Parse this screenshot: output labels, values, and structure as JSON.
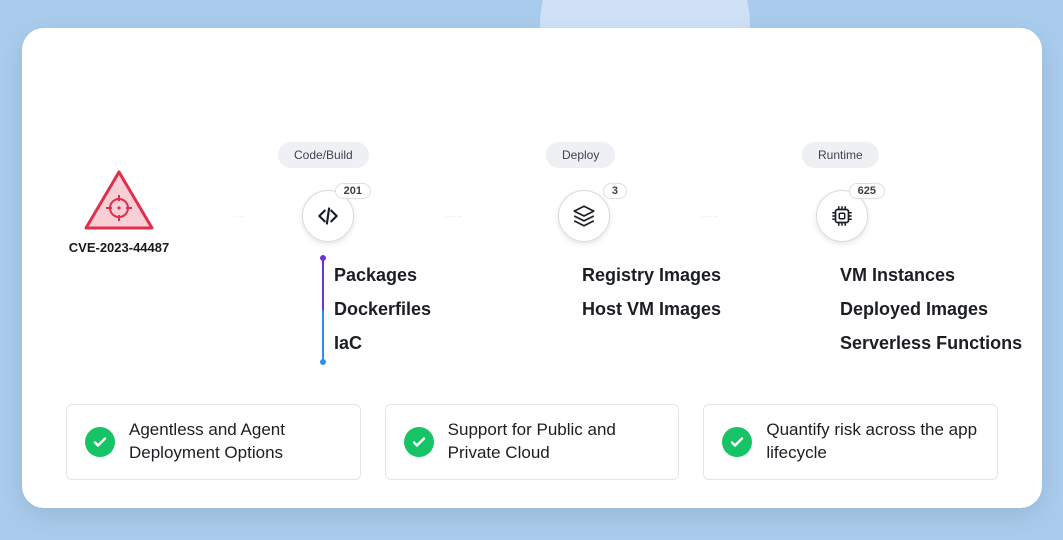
{
  "cve": {
    "id": "CVE-2023-44487"
  },
  "stages": [
    {
      "key": "code_build",
      "label": "Code/Build",
      "count": "201",
      "items": [
        "Packages",
        "Dockerfiles",
        "IaC"
      ]
    },
    {
      "key": "deploy",
      "label": "Deploy",
      "count": "3",
      "items": [
        "Registry Images",
        "Host  VM Images"
      ]
    },
    {
      "key": "runtime",
      "label": "Runtime",
      "count": "625",
      "items": [
        "VM Instances",
        "Deployed Images",
        "Serverless Functions"
      ]
    }
  ],
  "features": [
    {
      "text": "Agentless and Agent Deployment Options"
    },
    {
      "text": "Support for Public and Private Cloud"
    },
    {
      "text": "Quantify risk across the app lifecycle"
    }
  ]
}
